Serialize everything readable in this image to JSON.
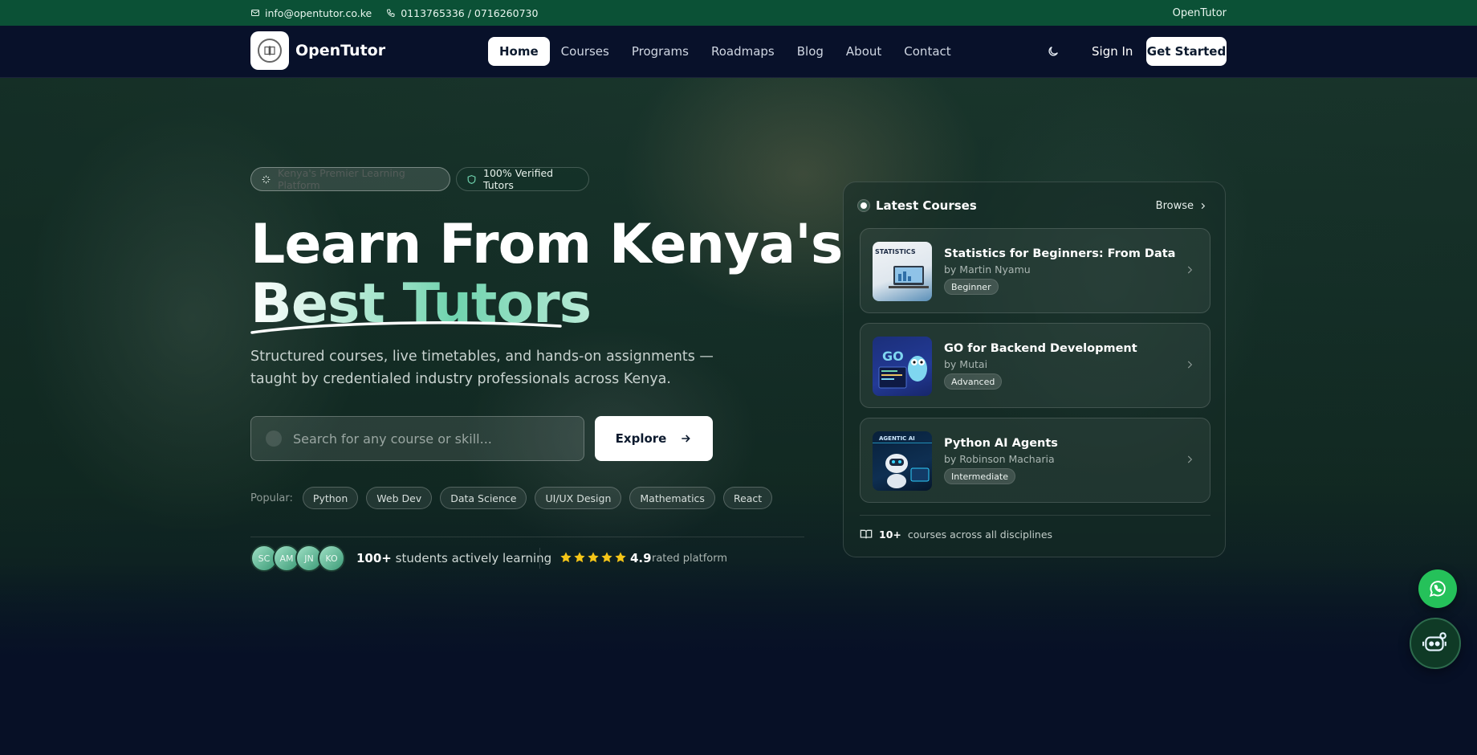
{
  "topbar": {
    "email": "info@opentutor.co.ke",
    "phone": "0113765336 / 0716260730",
    "brand": "OpenTutor"
  },
  "nav": {
    "logo_text": "OpenTutor",
    "links": [
      "Home",
      "Courses",
      "Programs",
      "Roadmaps",
      "Blog",
      "About",
      "Contact"
    ],
    "active": "Home",
    "signin": "Sign In",
    "get_started": "Get Started"
  },
  "hero": {
    "badge_primary": "Kenya's Premier Learning Platform",
    "badge_secondary": "100% Verified Tutors",
    "headline_line1": "Learn From Kenya's",
    "headline_line2": "Best Tutors",
    "subtitle_line1": "Structured courses, live timetables, and hands-on assignments —",
    "subtitle_line2": "taught by credentialed industry professionals across Kenya.",
    "search_placeholder": "Search for any course or skill...",
    "explore": "Explore",
    "popular_label": "Popular:",
    "popular_tags": [
      "Python",
      "Web Dev",
      "Data Science",
      "UI/UX Design",
      "Mathematics",
      "React"
    ],
    "avatars": [
      "SC",
      "AM",
      "JN",
      "KO"
    ],
    "students_count": "100+",
    "students_text": "students actively learning",
    "rating": "4.9",
    "rating_text": "rated platform",
    "star_count": 5
  },
  "courses_panel": {
    "title": "Latest Courses",
    "browse": "Browse",
    "courses": [
      {
        "title": "Statistics for Beginners: From Data to I...",
        "author": "by Martin Nyamu",
        "level": "Beginner",
        "thumb_text": "STATISTICS"
      },
      {
        "title": "GO for Backend Development",
        "author": "by Mutai",
        "level": "Advanced",
        "thumb_text": "GO"
      },
      {
        "title": "Python AI Agents",
        "author": "by Robinson Macharia",
        "level": "Intermediate",
        "thumb_text": "AGENTIC AI"
      }
    ],
    "footer_count": "10+",
    "footer_text": "courses across all disciplines"
  },
  "colors": {
    "topbar": "#0b5136",
    "navbar": "#08112a",
    "accent_green": "#6fd3ae",
    "whatsapp": "#25c15a",
    "star": "#f5c518"
  },
  "icons": [
    "mail-icon",
    "phone-icon",
    "moon-icon",
    "sparkle-icon",
    "shield-icon",
    "search-icon",
    "arrow-right-icon",
    "star-icon",
    "chevron-right-icon",
    "book-icon",
    "whatsapp-icon",
    "chatbot-icon"
  ]
}
